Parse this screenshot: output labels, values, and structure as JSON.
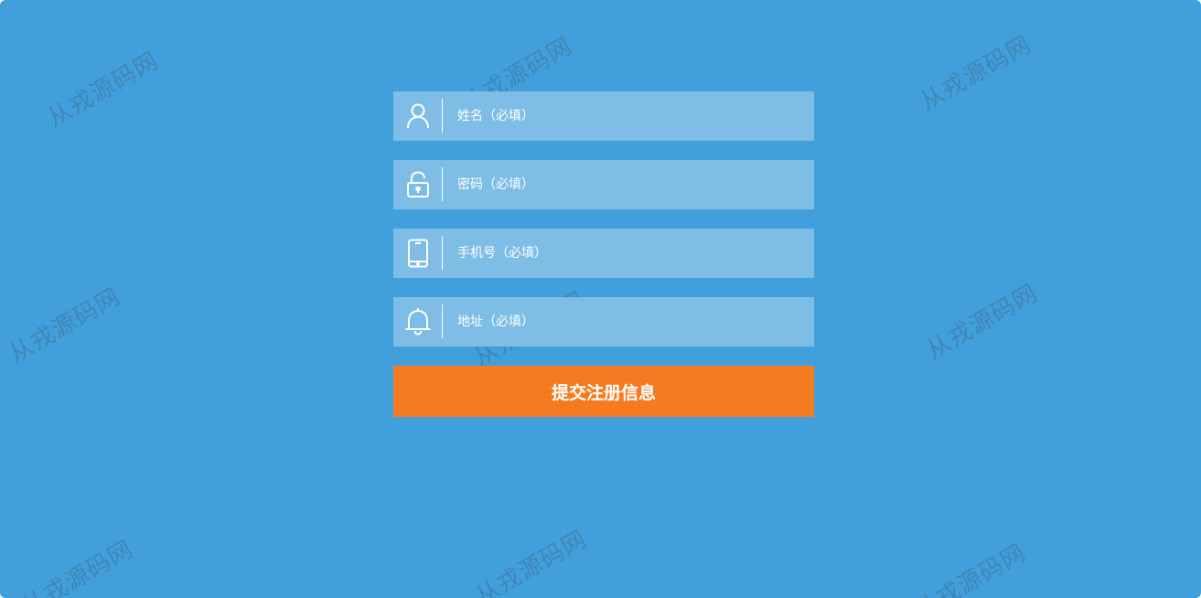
{
  "watermark": {
    "text": "从戎源码网"
  },
  "form": {
    "fields": [
      {
        "icon": "user-icon",
        "placeholder": "姓名（必填）"
      },
      {
        "icon": "lock-icon",
        "placeholder": "密码（必填）"
      },
      {
        "icon": "phone-icon",
        "placeholder": "手机号（必填）"
      },
      {
        "icon": "bell-icon",
        "placeholder": "地址（必填）"
      }
    ],
    "submit_label": "提交注册信息"
  },
  "colors": {
    "background": "#41a0db",
    "field_background": "#7ebee6",
    "submit_background": "#f57b20",
    "text": "#ffffff"
  }
}
